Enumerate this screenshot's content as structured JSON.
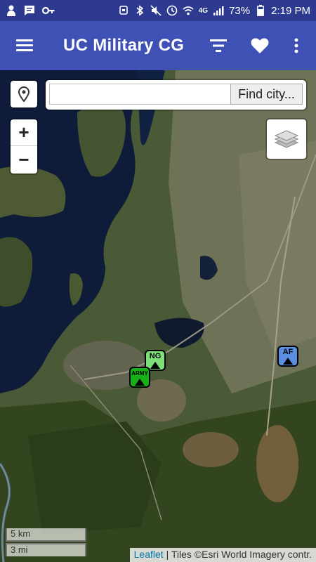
{
  "status_bar": {
    "battery": "73%",
    "time": "2:19 PM",
    "network": "4G"
  },
  "app_bar": {
    "title": "UC Military CG"
  },
  "map": {
    "search": {
      "placeholder": "",
      "value": "",
      "button_label": "Find city..."
    },
    "zoom_in_label": "+",
    "zoom_out_label": "−",
    "markers": [
      {
        "label": "NG",
        "color": "#7ee07a"
      },
      {
        "label": "ARMY",
        "color": "#18b018"
      },
      {
        "label": "AF",
        "color": "#5a8fe0"
      }
    ],
    "scale": {
      "km": "5 km",
      "mi": "3 mi"
    },
    "attribution": {
      "link": "Leaflet",
      "text": "| Tiles ©Esri World Imagery contr."
    }
  },
  "colors": {
    "status_bar": "#2e3a8f",
    "app_bar": "#3f51b5",
    "water": "#0e1c3a"
  }
}
